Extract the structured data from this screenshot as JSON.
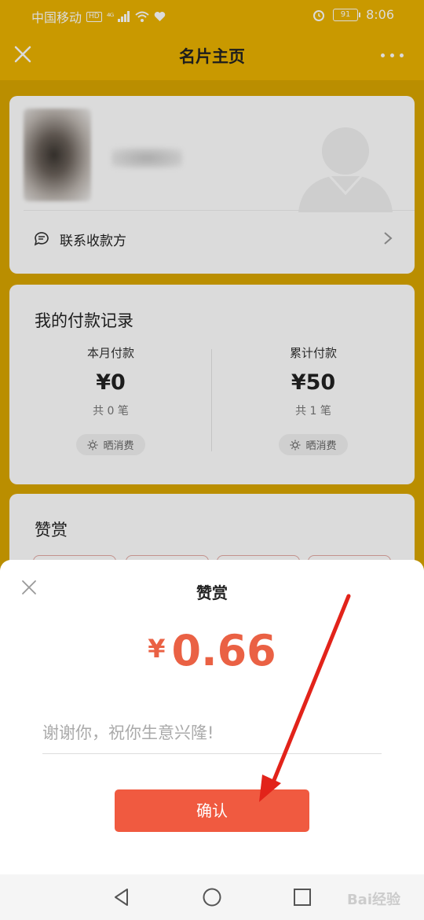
{
  "status_bar": {
    "carrier": "中国移动",
    "hd": "HD",
    "network": "⁴ᴳ",
    "battery": "91",
    "time": "8:06"
  },
  "navbar": {
    "title": "名片主页",
    "close_icon": "close-icon",
    "more_icon": "more-icon"
  },
  "profile": {
    "contact_label": "联系收款方"
  },
  "payments": {
    "title": "我的付款记录",
    "month": {
      "label": "本月付款",
      "amount": "¥0",
      "count": "共 0 笔",
      "share": "晒消费"
    },
    "total": {
      "label": "累计付款",
      "amount": "¥50",
      "count": "共 1 笔",
      "share": "晒消费"
    }
  },
  "reward_card": {
    "title": "赞赏"
  },
  "sheet": {
    "title": "赞赏",
    "currency": "¥",
    "amount": "0.66",
    "message": "谢谢你，祝你生意兴隆!",
    "confirm_label": "确认"
  },
  "watermark": "Bai经验",
  "colors": {
    "header": "#ebb300",
    "accent": "#ea6144",
    "confirm_button": "#f05a40"
  }
}
